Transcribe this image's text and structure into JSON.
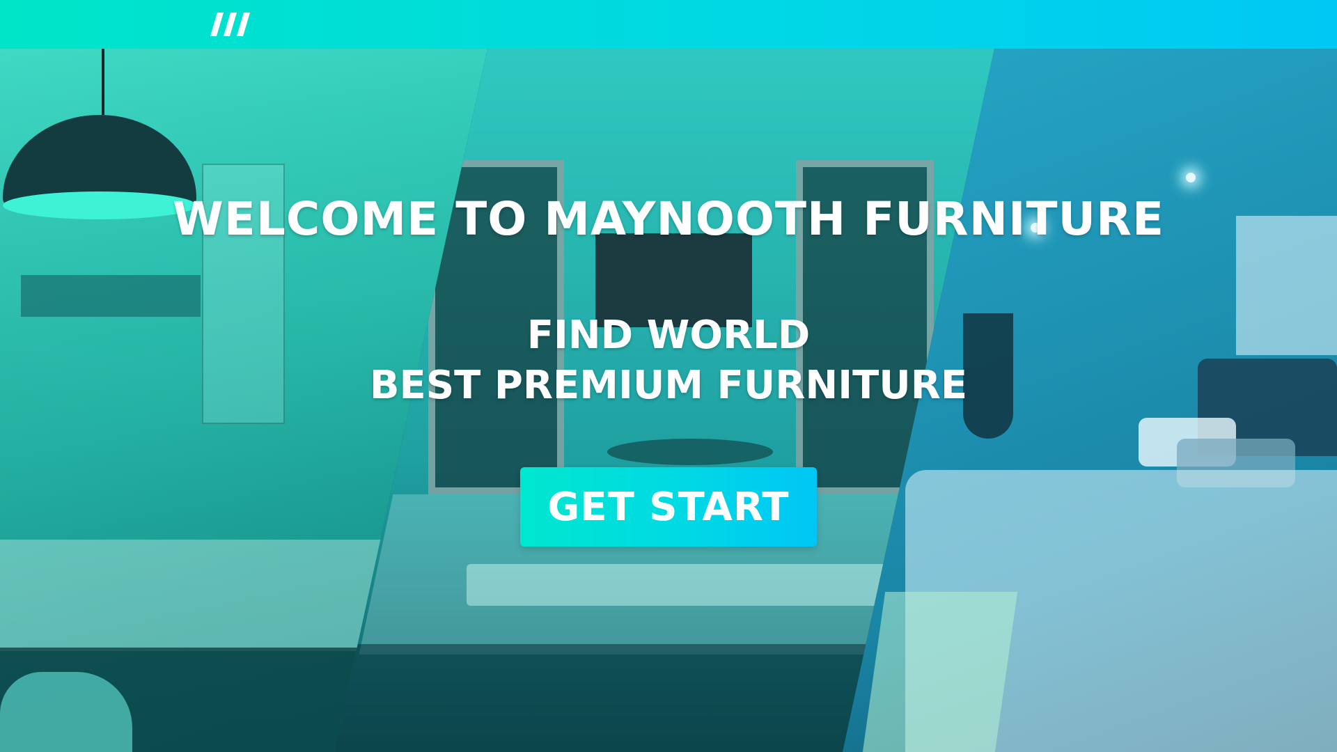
{
  "navbar": {
    "logo_icon": "brand-logo-icon",
    "gradient_start": "#00e5c8",
    "gradient_end": "#00c8f5"
  },
  "hero": {
    "welcome_title": "WELCOME TO MAYNOOTH FURNITURE",
    "tagline_line1": "FIND WORLD",
    "tagline_line2": "BEST PREMIUM FURNITURE",
    "cta_label": "GET START",
    "cta_gradient_start": "#00e7cf",
    "cta_gradient_end": "#00c6f6"
  }
}
